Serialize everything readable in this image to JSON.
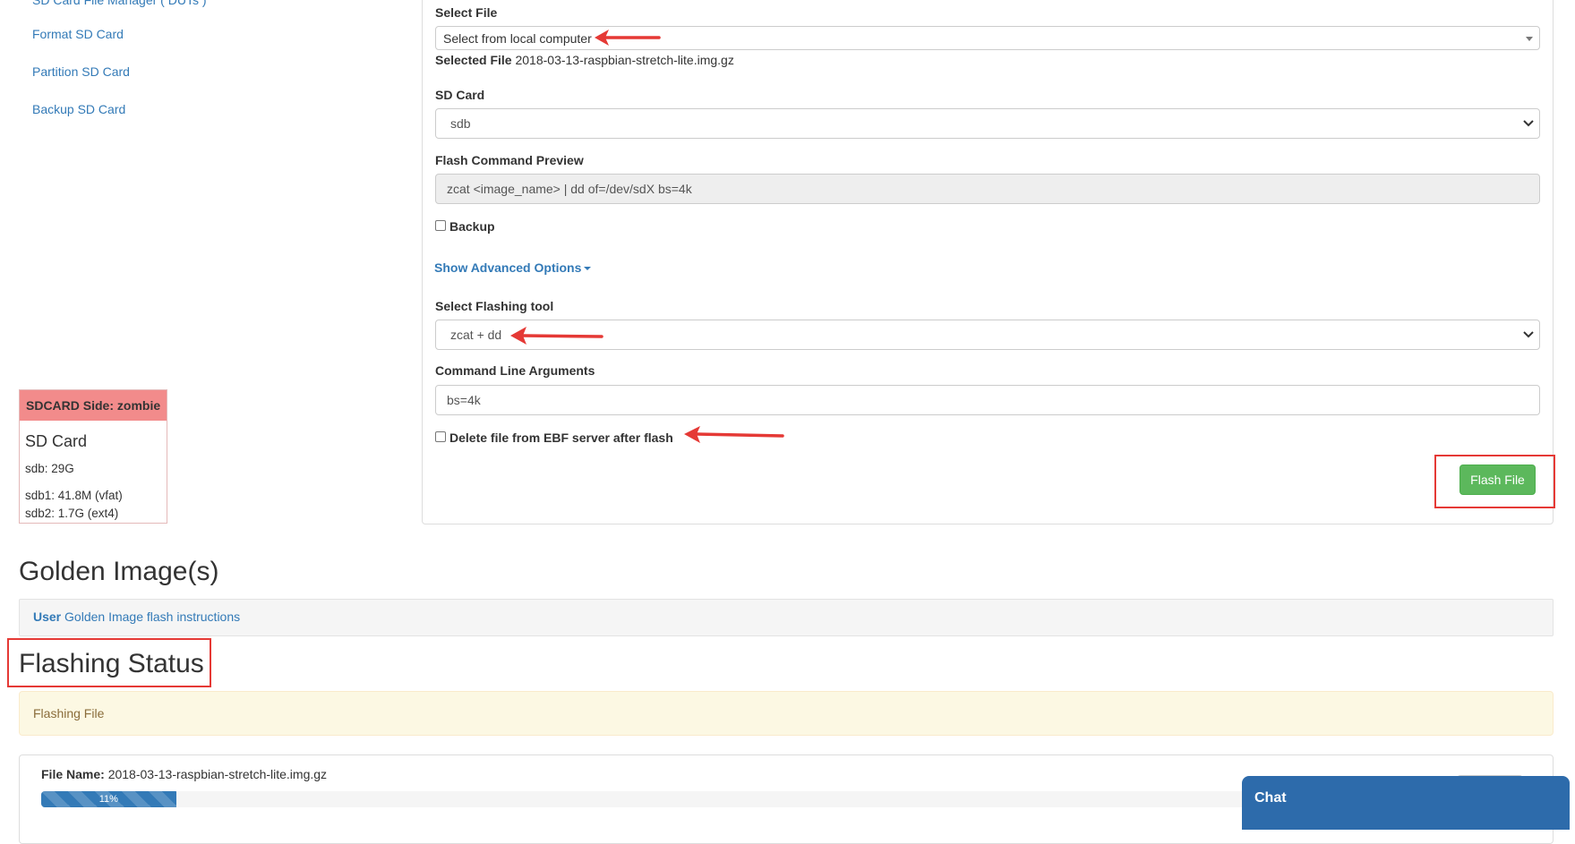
{
  "colors": {
    "link": "#337ab7",
    "danger_header": "#f28b8b",
    "success_button": "#5cb85c",
    "warning_bg": "#fcf8e3",
    "annotation_red": "#e53935",
    "chat_bg": "#2d6bab"
  },
  "sidebar": {
    "items": [
      {
        "label": "SD Card File Manager ( DUTs )"
      },
      {
        "label": "Format SD Card"
      },
      {
        "label": "Partition SD Card"
      },
      {
        "label": "Backup SD Card"
      }
    ]
  },
  "sdcard_panel": {
    "header": "SDCARD Side: zombie",
    "title": "SD Card",
    "lines": [
      "sdb: 29G",
      "sdb1: 41.8M (vfat)",
      "sdb2: 1.7G (ext4)"
    ]
  },
  "form": {
    "select_file": {
      "label": "Select File",
      "value": "Select from local computer"
    },
    "selected_file": {
      "label": "Selected File",
      "value": "2018-03-13-raspbian-stretch-lite.img.gz"
    },
    "sd_card": {
      "label": "SD Card",
      "value": "sdb"
    },
    "flash_command_preview": {
      "label": "Flash Command Preview",
      "value": "zcat <image_name> | dd of=/dev/sdX bs=4k"
    },
    "backup": {
      "label": "Backup",
      "checked": false
    },
    "advanced_link": "Show Advanced Options",
    "flashing_tool": {
      "label": "Select Flashing tool",
      "value": "zcat + dd"
    },
    "cmd_args": {
      "label": "Command Line Arguments",
      "value": "bs=4k"
    },
    "delete_after_flash": {
      "label": "Delete file from EBF server after flash",
      "checked": false
    },
    "flash_button": "Flash File"
  },
  "golden": {
    "heading": "Golden Image(s)",
    "user_label": "User",
    "link": "Golden Image flash instructions"
  },
  "status": {
    "heading": "Flashing Status",
    "alert": "Flashing File",
    "file_name_label": "File Name:",
    "file_name": "2018-03-13-raspbian-stretch-lite.img.gz",
    "progress_percent": 11,
    "progress_label": "11%"
  },
  "chat": {
    "label": "Chat"
  },
  "icons": [
    "dropdown-caret-icon",
    "select-chevron-icon",
    "red-arrow-icon"
  ]
}
